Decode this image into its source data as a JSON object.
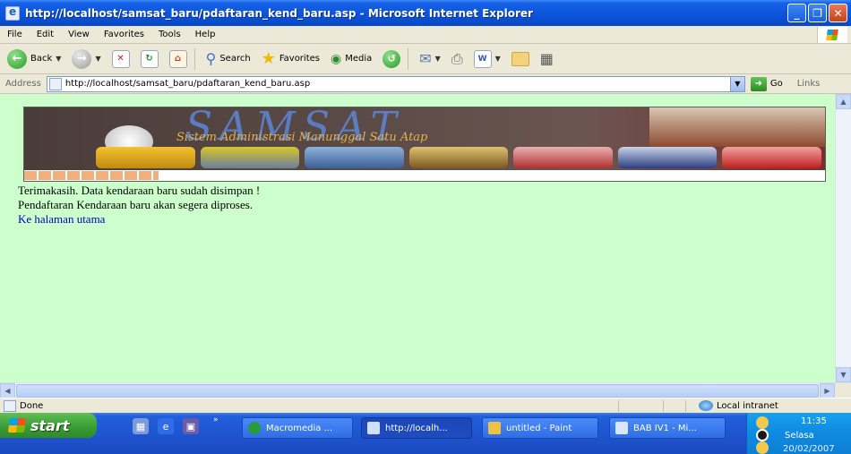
{
  "window": {
    "title": "http://localhost/samsat_baru/pdaftaran_kend_baru.asp - Microsoft Internet Explorer",
    "buttons": [
      "_",
      "❐",
      "✕"
    ]
  },
  "menu": [
    "File",
    "Edit",
    "View",
    "Favorites",
    "Tools",
    "Help"
  ],
  "toolbar": {
    "back": "Back",
    "search": "Search",
    "favorites": "Favorites",
    "media": "Media"
  },
  "address": {
    "label": "Address",
    "url": "http://localhost/samsat_baru/pdaftaran_kend_baru.asp",
    "go": "Go",
    "links": "Links"
  },
  "page": {
    "banner": {
      "title": "SAMSAT",
      "subtitle": "Sistem Administrasi Manunggal Satu Atap"
    },
    "message1": "Terimakasih. Data kendaraan baru sudah disimpan !",
    "message2": "Pendaftaran Kendaraan baru akan segera diproses.",
    "home_link": "Ke halaman utama"
  },
  "status": {
    "text": "Done",
    "zone": "Local intranet"
  },
  "taskbar": {
    "start": "start",
    "tasks": [
      {
        "label": "Macromedia ...",
        "icon": "dreamweaver-icon"
      },
      {
        "label": "http://localh...",
        "icon": "ie-icon",
        "active": true
      },
      {
        "label": "untitled - Paint",
        "icon": "paint-icon"
      },
      {
        "label": "BAB IV1 - Mi...",
        "icon": "word-icon"
      }
    ],
    "clock": {
      "time": "11:35",
      "day": "Selasa",
      "date": "20/02/2007"
    }
  }
}
